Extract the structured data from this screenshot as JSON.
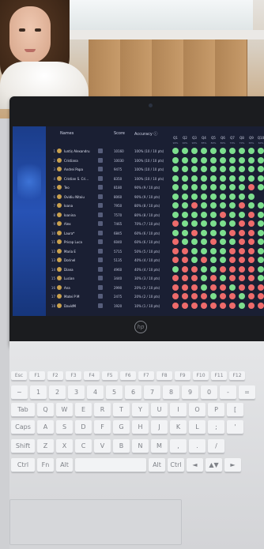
{
  "dashboard": {
    "headers": {
      "names": "Names",
      "score": "Score",
      "accuracy": "Accuracy ⓘ"
    },
    "questions": [
      "Q1",
      "Q2",
      "Q3",
      "Q4",
      "Q5",
      "Q6",
      "Q7",
      "Q8",
      "Q9",
      "Q10"
    ],
    "question_pcts": [
      "90%",
      "90%",
      "90%",
      "85%",
      "80%",
      "80%",
      "70%",
      "70%",
      "65%",
      "60%"
    ],
    "rows": [
      {
        "rank": "1",
        "name": "luntiș Alexandru",
        "score": "10160",
        "accuracy": "100% (10 / 10 pts)",
        "answers": "gggggggggg"
      },
      {
        "rank": "2",
        "name": "Cristiana",
        "score": "10030",
        "accuracy": "100% (10 / 10 pts)",
        "answers": "gggggggggg"
      },
      {
        "rank": "3",
        "name": "Andrei Popa",
        "score": "9475",
        "accuracy": "100% (10 / 10 pts)",
        "answers": "gggggggggg"
      },
      {
        "rank": "4",
        "name": "Cristian S. Cri…",
        "score": "8350",
        "accuracy": "100% (10 / 10 pts)",
        "answers": "gggggggggg"
      },
      {
        "rank": "5",
        "name": "Teo",
        "score": "8180",
        "accuracy": "90% (9 / 10 pts)",
        "answers": "ggggggggrg"
      },
      {
        "rank": "6",
        "name": "Ovidiu Nitoiu",
        "score": "8060",
        "accuracy": "90% (9 / 10 pts)",
        "answers": "ggggggggg"
      },
      {
        "rank": "7",
        "name": "Ioana",
        "score": "7950",
        "accuracy": "80% (8 / 10 pts)",
        "answers": "ggrggggrgg"
      },
      {
        "rank": "8",
        "name": "Ioanina",
        "score": "7570",
        "accuracy": "80% (8 / 10 pts)",
        "answers": "gggggrggrg"
      },
      {
        "rank": "9",
        "name": "Alex",
        "score": "7465",
        "accuracy": "70% (7 / 10 pts)",
        "answers": "rggggggrrg"
      },
      {
        "rank": "10",
        "name": "Laura*",
        "score": "6845",
        "accuracy": "60% (6 / 10 pts)",
        "answers": "ggrgggrrrg"
      },
      {
        "rank": "11",
        "name": "Pricop Luca",
        "score": "6040",
        "accuracy": "60% (6 / 10 pts)",
        "answers": "rgggrggrrg"
      },
      {
        "rank": "12",
        "name": "Maria E",
        "score": "5715",
        "accuracy": "50% (5 / 10 pts)",
        "answers": "rrggggrrrg"
      },
      {
        "rank": "13",
        "name": "Dorinel",
        "score": "5135",
        "accuracy": "40% (4 / 10 pts)",
        "answers": "rrgrggrrrg"
      },
      {
        "rank": "14",
        "name": "Diana",
        "score": "4960",
        "accuracy": "40% (4 / 10 pts)",
        "answers": "grrggrrrrg"
      },
      {
        "rank": "15",
        "name": "Lucian",
        "score": "3440",
        "accuracy": "30% (3 / 10 pts)",
        "answers": "rrrgrgrrrg"
      },
      {
        "rank": "16",
        "name": "Ana",
        "score": "2990",
        "accuracy": "20% (2 / 10 pts)",
        "answers": "rrrgrrgrrr"
      },
      {
        "rank": "17",
        "name": "Matei P M",
        "score": "2475",
        "accuracy": "20% (2 / 10 pts)",
        "answers": "rrrrgrrgrr"
      },
      {
        "rank": "18",
        "name": "DavidM",
        "score": "1920",
        "accuracy": "10% (1 / 10 pts)",
        "answers": "rrrrrrrgrr"
      }
    ]
  },
  "laptop_logo": "hp",
  "colors": {
    "correct": "#7ddf8e",
    "wrong": "#ee6b6b",
    "screen_bg": "#1a1f33"
  },
  "keyboard": {
    "row1": [
      "Esc",
      "F1",
      "F2",
      "F3",
      "F4",
      "F5",
      "F6",
      "F7",
      "F8",
      "F9",
      "F10",
      "F11",
      "F12"
    ],
    "row2": [
      "~",
      "1",
      "2",
      "3",
      "4",
      "5",
      "6",
      "7",
      "8",
      "9",
      "0",
      "-",
      "="
    ],
    "row3": [
      "Tab",
      "Q",
      "W",
      "E",
      "R",
      "T",
      "Y",
      "U",
      "I",
      "O",
      "P",
      "[",
      "]"
    ],
    "row4": [
      "Caps",
      "A",
      "S",
      "D",
      "F",
      "G",
      "H",
      "J",
      "K",
      "L",
      ";",
      "'"
    ],
    "row5": [
      "Shift",
      "Z",
      "X",
      "C",
      "V",
      "B",
      "N",
      "M",
      ",",
      ".",
      "/"
    ],
    "row6": [
      "Ctrl",
      "Fn",
      "Alt",
      "",
      "Alt",
      "Ctrl",
      "◄",
      "▲▼",
      "►"
    ]
  }
}
